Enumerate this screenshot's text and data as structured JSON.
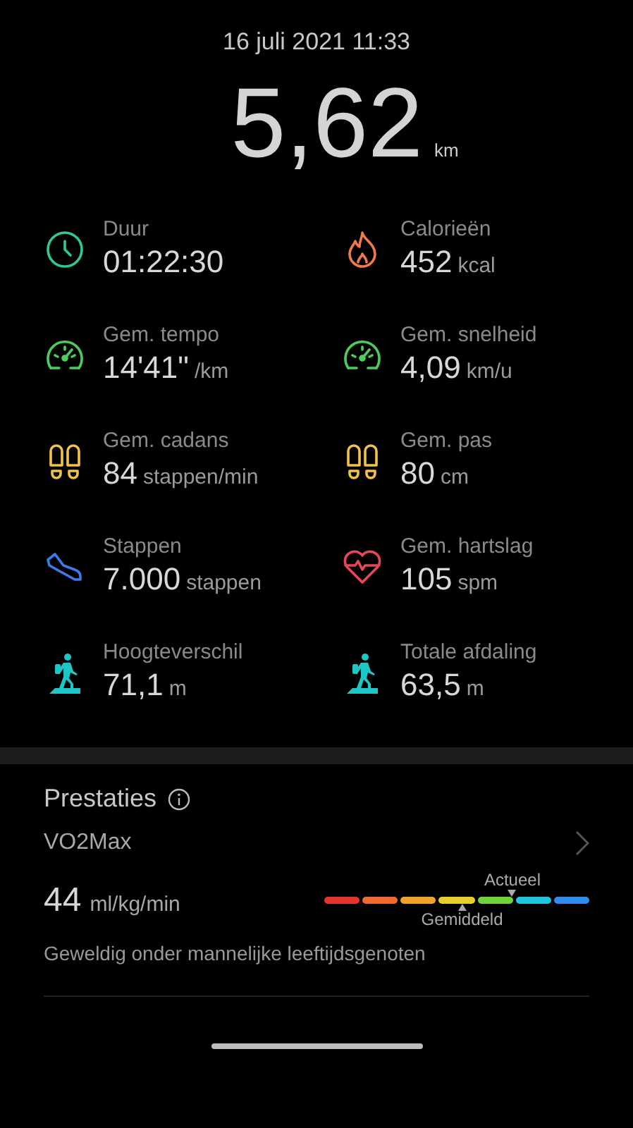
{
  "header": {
    "date": "16 juli 2021 11:33",
    "distance": "5,62",
    "distance_unit": "km"
  },
  "stats": [
    {
      "kind": "clock",
      "color": "#2ec89a",
      "label": "Duur",
      "value": "01:22:30"
    },
    {
      "kind": "flame",
      "color": "#f07a4a",
      "label": "Calorieën",
      "value": "452",
      "unit": "kcal"
    },
    {
      "kind": "gauge",
      "color": "#4ccc5c",
      "label": "Gem. tempo",
      "value": "14'41\"",
      "unit": "/km"
    },
    {
      "kind": "gauge",
      "color": "#4ccc5c",
      "label": "Gem. snelheid",
      "value": "4,09",
      "unit": "km/u"
    },
    {
      "kind": "feet",
      "color": "#f2c14a",
      "label": "Gem. cadans",
      "value": "84",
      "unit": "stappen/min"
    },
    {
      "kind": "feet",
      "color": "#f2c14a",
      "label": "Gem. pas",
      "value": "80",
      "unit": "cm"
    },
    {
      "kind": "shoe",
      "color": "#3f7be8",
      "label": "Stappen",
      "value": "7.000",
      "unit": "stappen"
    },
    {
      "kind": "heart",
      "color": "#e8455a",
      "label": "Gem. hartslag",
      "value": "105",
      "unit": "spm"
    },
    {
      "kind": "hiker",
      "color": "#1fc6c6",
      "label": "Hoogteverschil",
      "value": "71,1",
      "unit": "m"
    },
    {
      "kind": "hiker",
      "color": "#1fc6c6",
      "label": "Totale afdaling",
      "value": "63,5",
      "unit": "m"
    }
  ],
  "performance": {
    "title": "Prestaties",
    "metric": "VO2Max",
    "value": "44",
    "unit": "ml/kg/min",
    "scale": {
      "segments": [
        {
          "color": "#e8352c"
        },
        {
          "color": "#ef6a2c"
        },
        {
          "color": "#f2a22c"
        },
        {
          "color": "#e6cf2a"
        },
        {
          "color": "#6fd43a"
        },
        {
          "color": "#1fc4e0"
        },
        {
          "color": "#2e8ef0"
        }
      ],
      "current": {
        "label": "Actueel"
      },
      "average": {
        "label": "Gemiddeld"
      }
    },
    "rating": "Geweldig onder mannelijke leeftijdsgenoten"
  }
}
